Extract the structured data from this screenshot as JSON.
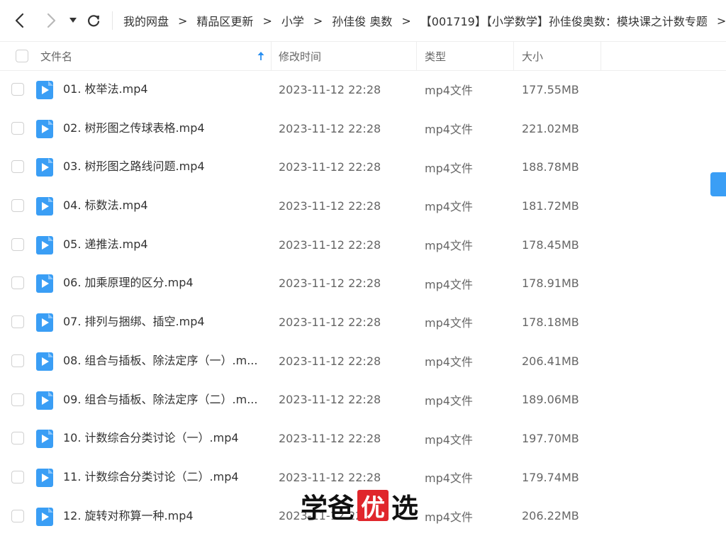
{
  "nav": {
    "back_icon": "chevron-left-icon",
    "forward_icon": "chevron-right-icon",
    "dropdown_icon": "caret-down-icon",
    "refresh_icon": "refresh-icon",
    "breadcrumb": [
      "我的网盘",
      "精品区更新",
      "小学",
      "孙佳俊 奥数",
      "【001719】【小学数学】孙佳俊奥数：模块课之计数专题"
    ],
    "separator": ">"
  },
  "columns": {
    "name": "文件名",
    "modified": "修改时间",
    "type": "类型",
    "size": "大小"
  },
  "files": [
    {
      "name": "01. 枚举法.mp4",
      "modified": "2023-11-12 22:28",
      "type": "mp4文件",
      "size": "177.55MB"
    },
    {
      "name": "02. 树形图之传球表格.mp4",
      "modified": "2023-11-12 22:28",
      "type": "mp4文件",
      "size": "221.02MB"
    },
    {
      "name": "03. 树形图之路线问题.mp4",
      "modified": "2023-11-12 22:28",
      "type": "mp4文件",
      "size": "188.78MB"
    },
    {
      "name": "04. 标数法.mp4",
      "modified": "2023-11-12 22:28",
      "type": "mp4文件",
      "size": "181.72MB"
    },
    {
      "name": "05. 递推法.mp4",
      "modified": "2023-11-12 22:28",
      "type": "mp4文件",
      "size": "178.45MB"
    },
    {
      "name": "06. 加乘原理的区分.mp4",
      "modified": "2023-11-12 22:28",
      "type": "mp4文件",
      "size": "178.91MB"
    },
    {
      "name": "07. 排列与捆绑、插空.mp4",
      "modified": "2023-11-12 22:28",
      "type": "mp4文件",
      "size": "178.18MB"
    },
    {
      "name": "08. 组合与插板、除法定序（一）.m...",
      "modified": "2023-11-12 22:28",
      "type": "mp4文件",
      "size": "206.41MB"
    },
    {
      "name": "09. 组合与插板、除法定序（二）.m...",
      "modified": "2023-11-12 22:28",
      "type": "mp4文件",
      "size": "189.06MB"
    },
    {
      "name": "10. 计数综合分类讨论（一）.mp4",
      "modified": "2023-11-12 22:28",
      "type": "mp4文件",
      "size": "197.70MB"
    },
    {
      "name": "11. 计数综合分类讨论（二）.mp4",
      "modified": "2023-11-12 22:28",
      "type": "mp4文件",
      "size": "179.74MB"
    },
    {
      "name": "12. 旋转对称算一种.mp4",
      "modified": "2023-11-12 22:28",
      "type": "mp4文件",
      "size": "206.22MB"
    }
  ],
  "watermark": {
    "part1": "学爸",
    "seal": "优",
    "part2": "选"
  },
  "colors": {
    "accent": "#3a9ef5",
    "file_icon": "#3a9ef5",
    "seal": "#e0262c"
  },
  "icons": {
    "file": "video-file-icon",
    "sort": "sort-ascending-arrow-icon"
  }
}
